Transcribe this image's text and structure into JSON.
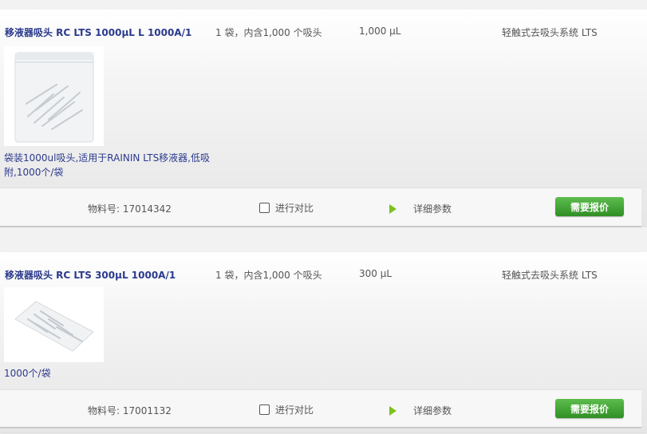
{
  "products": [
    {
      "title": "移液器吸头 RC LTS 1000µL L 1000A/1",
      "quantity": "1 袋，内含1,000 个吸头",
      "volume": "1,000 µL",
      "system": "轻触式去吸头系统 LTS",
      "description": "袋装1000ul吸头,适用于RAININ LTS移液器,低吸附,1000个/袋",
      "part_number": "物料号: 17014342",
      "compare_label": "进行对比",
      "details_label": "详细参数",
      "quote_label": "需要报价"
    },
    {
      "title": "移液器吸头 RC LTS 300µL 1000A/1",
      "quantity": "1 袋，内含1,000 个吸头",
      "volume": "300 µL",
      "system": "轻触式去吸头系统 LTS",
      "description": "1000个/袋",
      "part_number": "物料号: 17001132",
      "compare_label": "进行对比",
      "details_label": "详细参数",
      "quote_label": "需要报价"
    }
  ],
  "colors": {
    "title": "#2b3a8c",
    "quote_button": "#3f9f30",
    "detail_arrow": "#7cc21e"
  }
}
